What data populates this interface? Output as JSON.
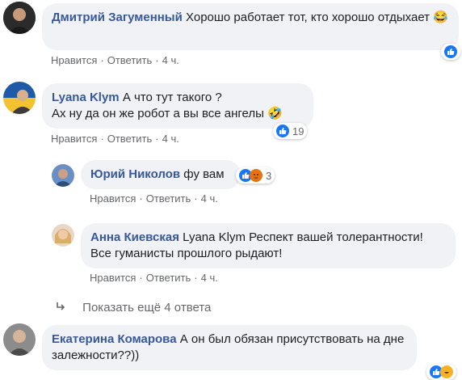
{
  "comments": [
    {
      "author": "Дмитрий Загуменный",
      "text": "Хорошо работает тот, кто хорошо отдыхает 😂"
    },
    {
      "author": "Lyana Klym",
      "text1": "А что тут такого ?",
      "text2": "Ах ну да он же робот а вы все ангелы 🤣",
      "reaction_count": "19"
    },
    {
      "author": "Юрий Николов",
      "text": "фу вам",
      "reaction_count": "3"
    },
    {
      "author": "Анна Киевская",
      "text1": "Lyana Klym Респект вашей толерантности!",
      "text2": "Все гуманисты прошлого рыдают!"
    },
    {
      "author": "Екатерина Комарова",
      "text1": "А он был обязан присутствовать на дне",
      "text2": "залежности??))"
    }
  ],
  "actions": {
    "like": "Нравится",
    "reply": "Ответить",
    "sep": "·",
    "time": "4 ч."
  },
  "show_more": "Показать ещё 4 ответа",
  "icons": {
    "like": "like-icon",
    "haha": "haha-icon",
    "angry": "angry-icon",
    "arrow": "reply-arrow-icon"
  },
  "colors": {
    "author": "#385898",
    "bubble": "#f0f2f5",
    "like": "#1877f2",
    "meta": "#65676b"
  }
}
